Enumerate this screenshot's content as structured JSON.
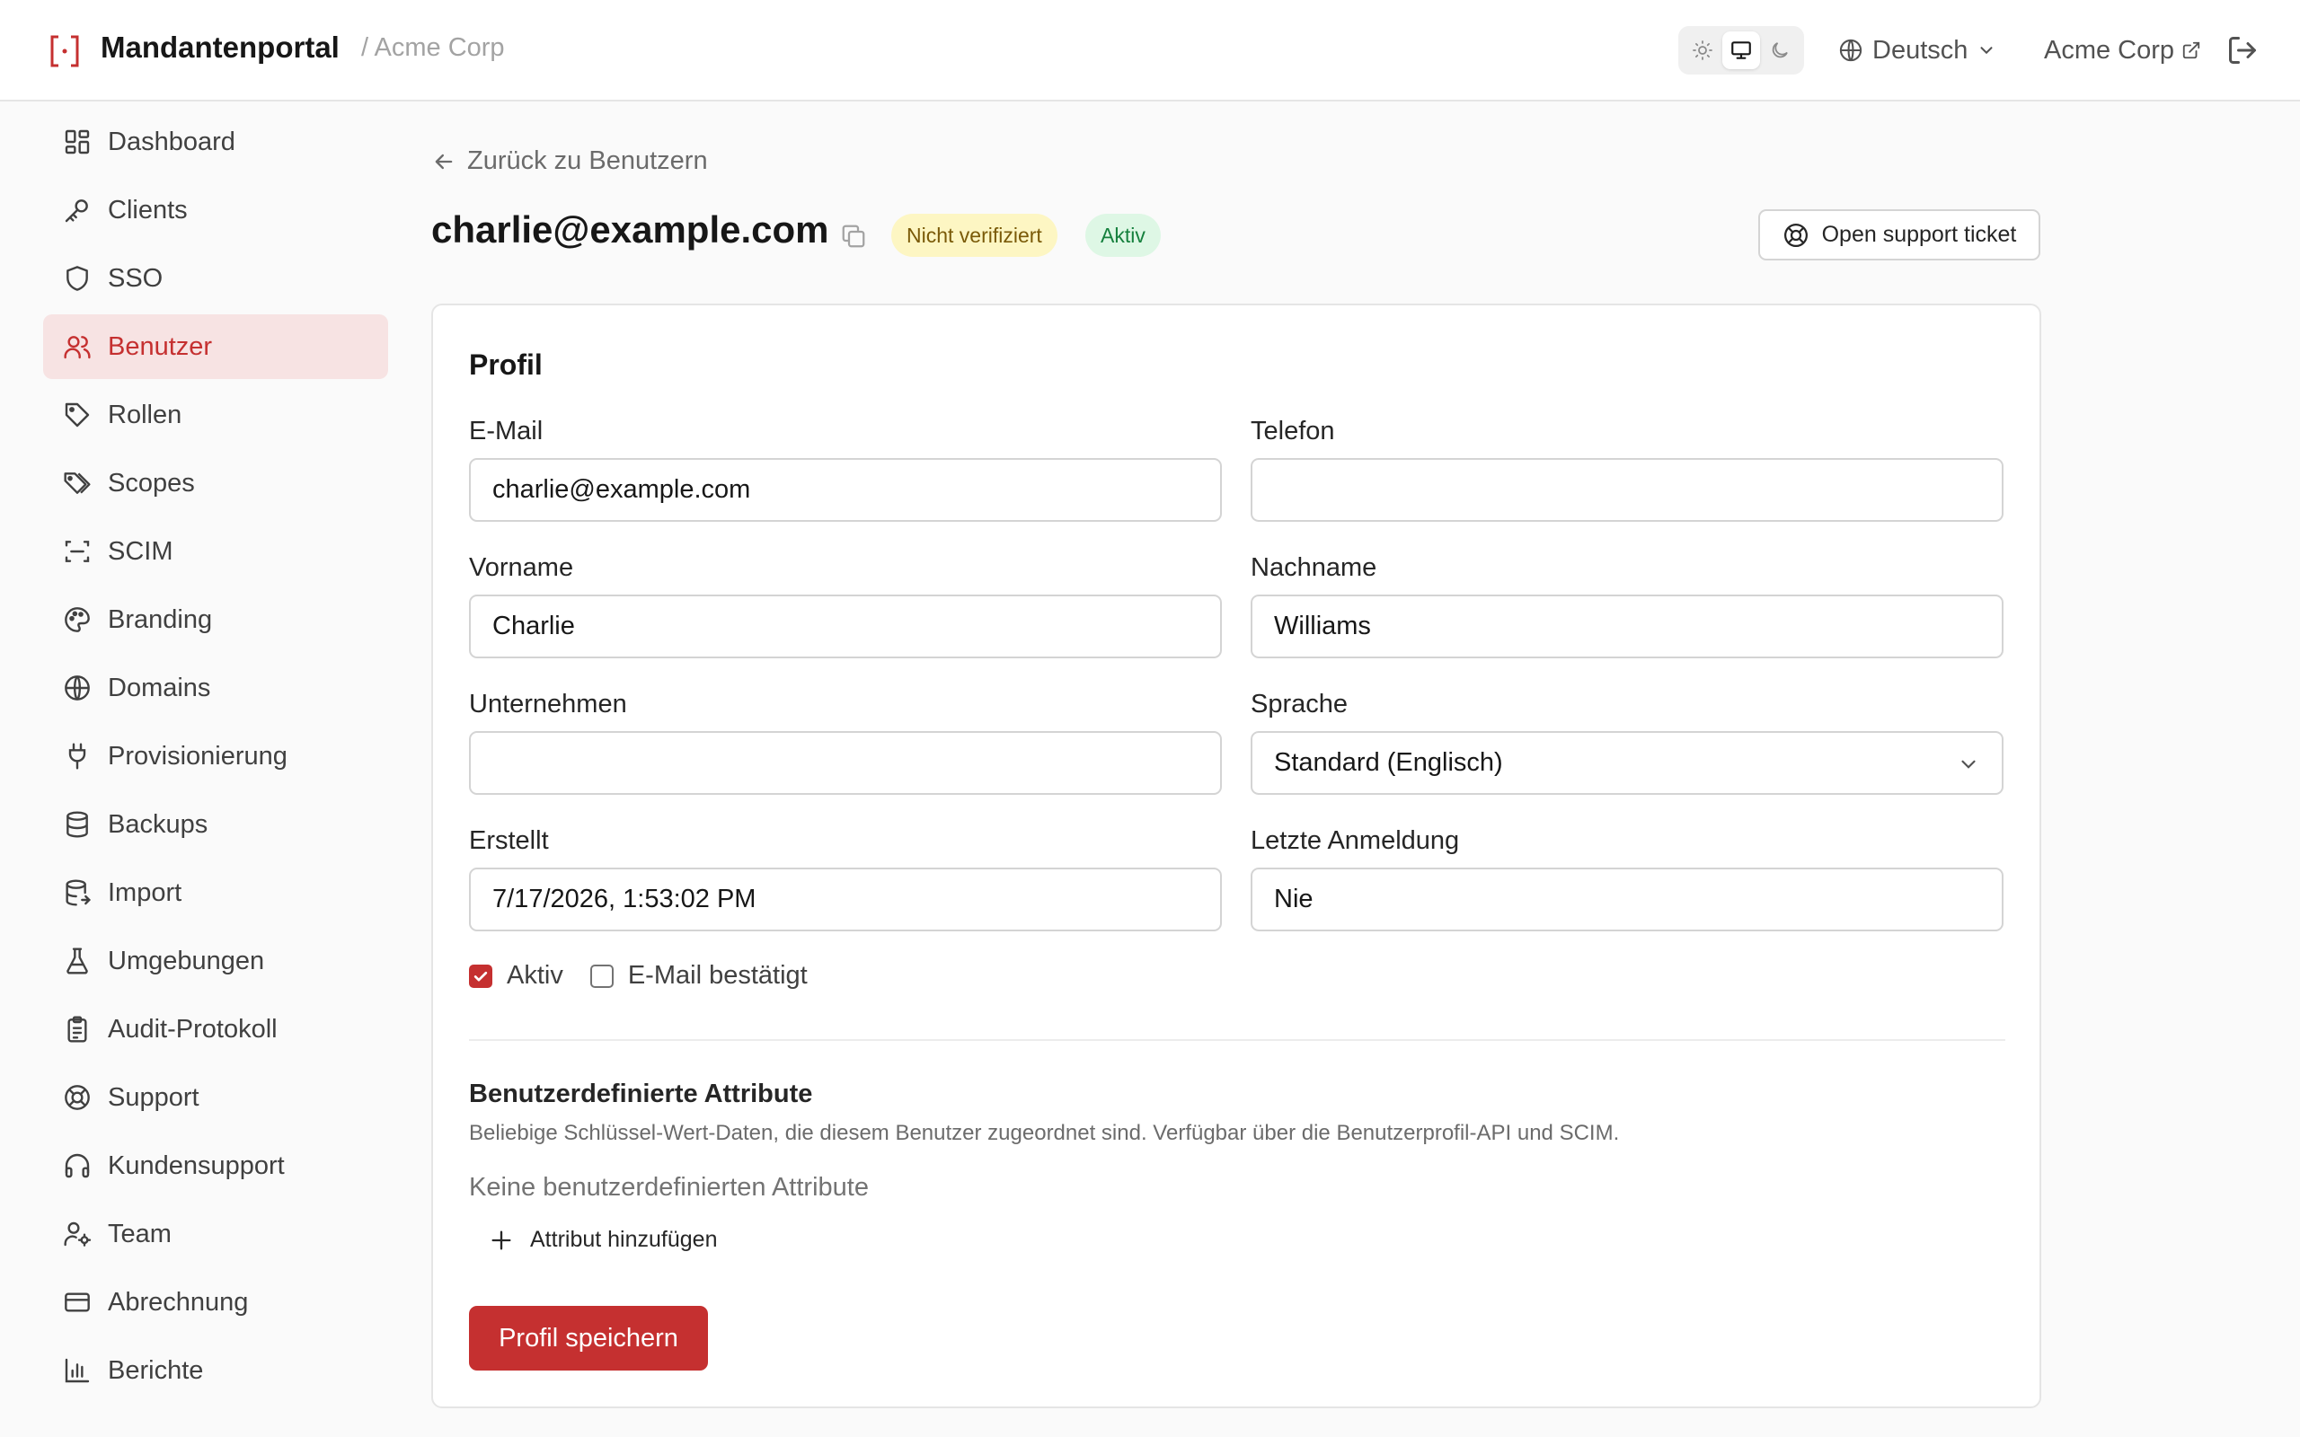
{
  "header": {
    "app_title": "Mandantenportal",
    "tenant_crumb": "/ Acme Corp",
    "language": "Deutsch",
    "org_name": "Acme Corp",
    "theme_selected": "system"
  },
  "sidebar": {
    "items": [
      {
        "label": "Dashboard",
        "icon": "dashboard-icon"
      },
      {
        "label": "Clients",
        "icon": "key-icon"
      },
      {
        "label": "SSO",
        "icon": "shield-icon"
      },
      {
        "label": "Benutzer",
        "icon": "users-icon",
        "active": true
      },
      {
        "label": "Rollen",
        "icon": "tag-icon"
      },
      {
        "label": "Scopes",
        "icon": "tags-icon"
      },
      {
        "label": "SCIM",
        "icon": "scan-icon"
      },
      {
        "label": "Branding",
        "icon": "palette-icon"
      },
      {
        "label": "Domains",
        "icon": "globe-icon"
      },
      {
        "label": "Provisionierung",
        "icon": "plug-icon"
      },
      {
        "label": "Backups",
        "icon": "database-icon"
      },
      {
        "label": "Import",
        "icon": "database-import-icon"
      },
      {
        "label": "Umgebungen",
        "icon": "flask-icon"
      },
      {
        "label": "Audit-Protokoll",
        "icon": "clipboard-icon"
      },
      {
        "label": "Support",
        "icon": "life-buoy-icon"
      },
      {
        "label": "Kundensupport",
        "icon": "headphones-icon"
      },
      {
        "label": "Team",
        "icon": "user-cog-icon"
      },
      {
        "label": "Abrechnung",
        "icon": "credit-card-icon"
      },
      {
        "label": "Berichte",
        "icon": "bar-chart-icon"
      }
    ]
  },
  "main": {
    "back_label": "Zurück zu Benutzern",
    "user_email": "charlie@example.com",
    "badge_unverified": "Nicht verifiziert",
    "badge_active": "Aktiv",
    "support_ticket_label": "Open support ticket"
  },
  "profile": {
    "title": "Profil",
    "email_label": "E-Mail",
    "email_value": "charlie@example.com",
    "phone_label": "Telefon",
    "phone_value": "",
    "firstname_label": "Vorname",
    "firstname_value": "Charlie",
    "lastname_label": "Nachname",
    "lastname_value": "Williams",
    "company_label": "Unternehmen",
    "company_value": "",
    "language_label": "Sprache",
    "language_value": "Standard (Englisch)",
    "created_label": "Erstellt",
    "created_value": "7/17/2026, 1:53:02 PM",
    "last_login_label": "Letzte Anmeldung",
    "last_login_value": "Nie",
    "active_checkbox_label": "Aktiv",
    "active_checked": true,
    "email_confirmed_label": "E-Mail bestätigt",
    "email_confirmed_checked": false,
    "custom_attr_title": "Benutzerdefinierte Attribute",
    "custom_attr_desc": "Beliebige Schlüssel-Wert-Daten, die diesem Benutzer zugeordnet sind. Verfügbar über die Benutzerprofil-API und SCIM.",
    "custom_attr_empty": "Keine benutzerdefinierten Attribute",
    "add_attr_label": "Attribut hinzufügen",
    "save_label": "Profil speichern"
  },
  "colors": {
    "accent": "#c53030",
    "active_nav_bg": "#f7e3e3",
    "badge_yellow_bg": "#fdf6c3",
    "badge_green_bg": "#def7e5"
  }
}
